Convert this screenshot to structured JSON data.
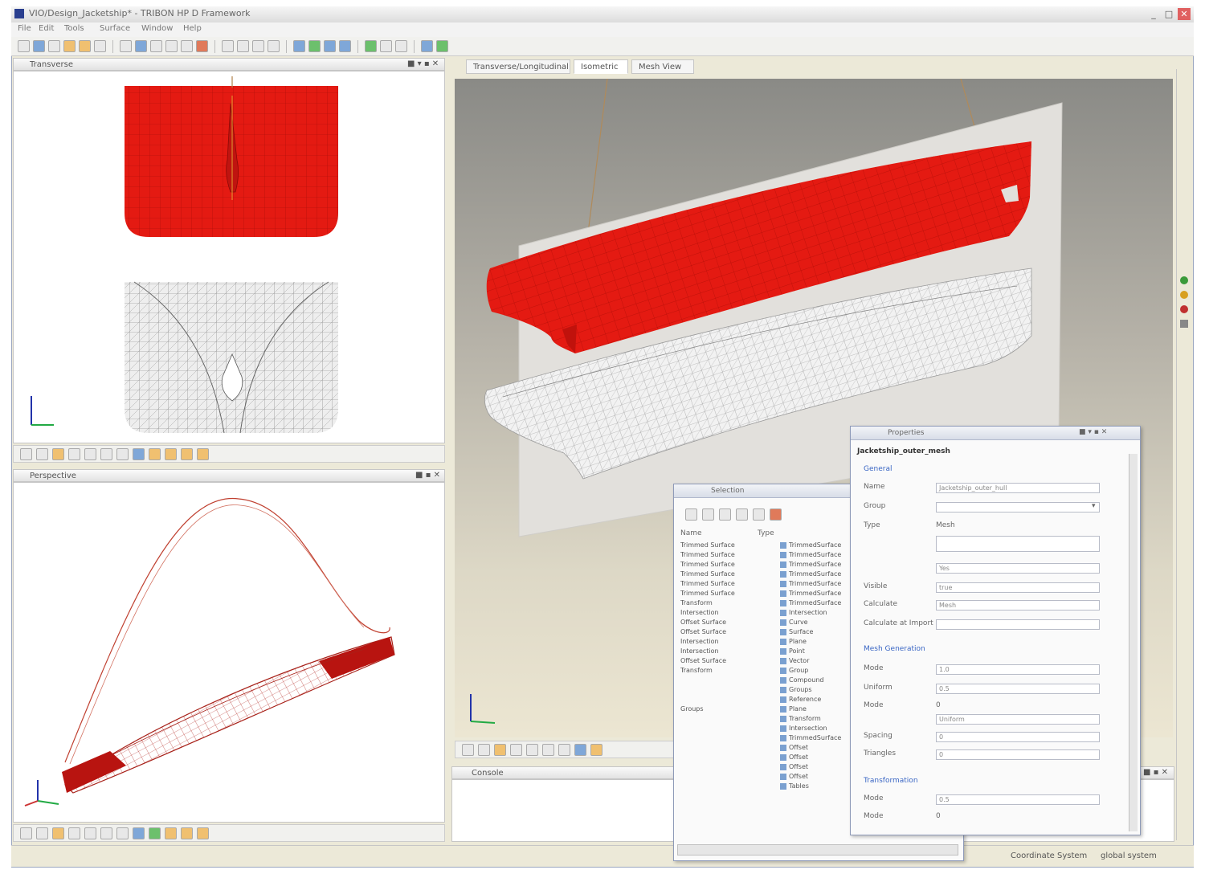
{
  "window": {
    "title": "VIO/Design_Jacketship* - TRIBON HP D Framework",
    "controls": [
      "_",
      "□",
      "✕"
    ]
  },
  "menu": [
    "File",
    "Edit",
    "Tools",
    "Surface",
    "Window",
    "Help"
  ],
  "panels": {
    "top_left": {
      "title": "Transverse"
    },
    "bottom_left": {
      "title": "Perspective"
    }
  },
  "tabs": [
    "Transverse/Longitudinal",
    "Isometric",
    "Mesh View"
  ],
  "console": {
    "title": "Console"
  },
  "status": {
    "left": "Coordinate System",
    "right": "global system"
  },
  "list_dialog": {
    "title": "Selection",
    "col_name": "Name",
    "col_type": "Type",
    "names": [
      "Trimmed Surface",
      "Trimmed Surface",
      "Trimmed Surface",
      "Trimmed Surface",
      "Trimmed Surface",
      "Trimmed Surface",
      "Transform",
      "Intersection",
      "Offset Surface",
      "Offset Surface",
      "Intersection",
      "Intersection",
      "Offset Surface",
      "Transform",
      "",
      "",
      "",
      "Groups"
    ],
    "types": [
      "TrimmedSurface",
      "TrimmedSurface",
      "TrimmedSurface",
      "TrimmedSurface",
      "TrimmedSurface",
      "TrimmedSurface",
      "TrimmedSurface",
      "Intersection",
      "Curve",
      "Surface",
      "Plane",
      "Point",
      "Vector",
      "Group",
      "Compound",
      "Groups",
      "Reference",
      "Plane",
      "Transform",
      "Intersection",
      "TrimmedSurface",
      "Offset",
      "Offset",
      "Offset",
      "Offset",
      "Tables"
    ]
  },
  "prop_dialog": {
    "title": "Properties",
    "header": "Jacketship_outer_mesh",
    "section1": "General",
    "labels1": [
      "Name",
      "Group",
      "Type",
      "",
      "",
      "Visible",
      "Calculate",
      "Calculate at Import"
    ],
    "values1": [
      "Jacketship_outer_hull",
      "",
      "Mesh",
      "",
      "Yes",
      "true",
      "Mesh"
    ],
    "section2": "Mesh Generation",
    "labels2": [
      "Mode",
      "Uniform",
      "Mode",
      "Spacing",
      "Spacing",
      "Triangles"
    ],
    "values2": [
      "1.0",
      "0.5",
      "0",
      "Uniform",
      "0",
      "0"
    ],
    "section3": "Transformation",
    "labels3": [
      "Mode",
      "Mode"
    ],
    "values3": [
      "0.5",
      "0"
    ]
  },
  "colors": {
    "hull_red": "#e41a12",
    "hull_red_dark": "#b80e08",
    "mesh_grey": "#8c8c8c",
    "accent_blue": "#3a66c4"
  }
}
